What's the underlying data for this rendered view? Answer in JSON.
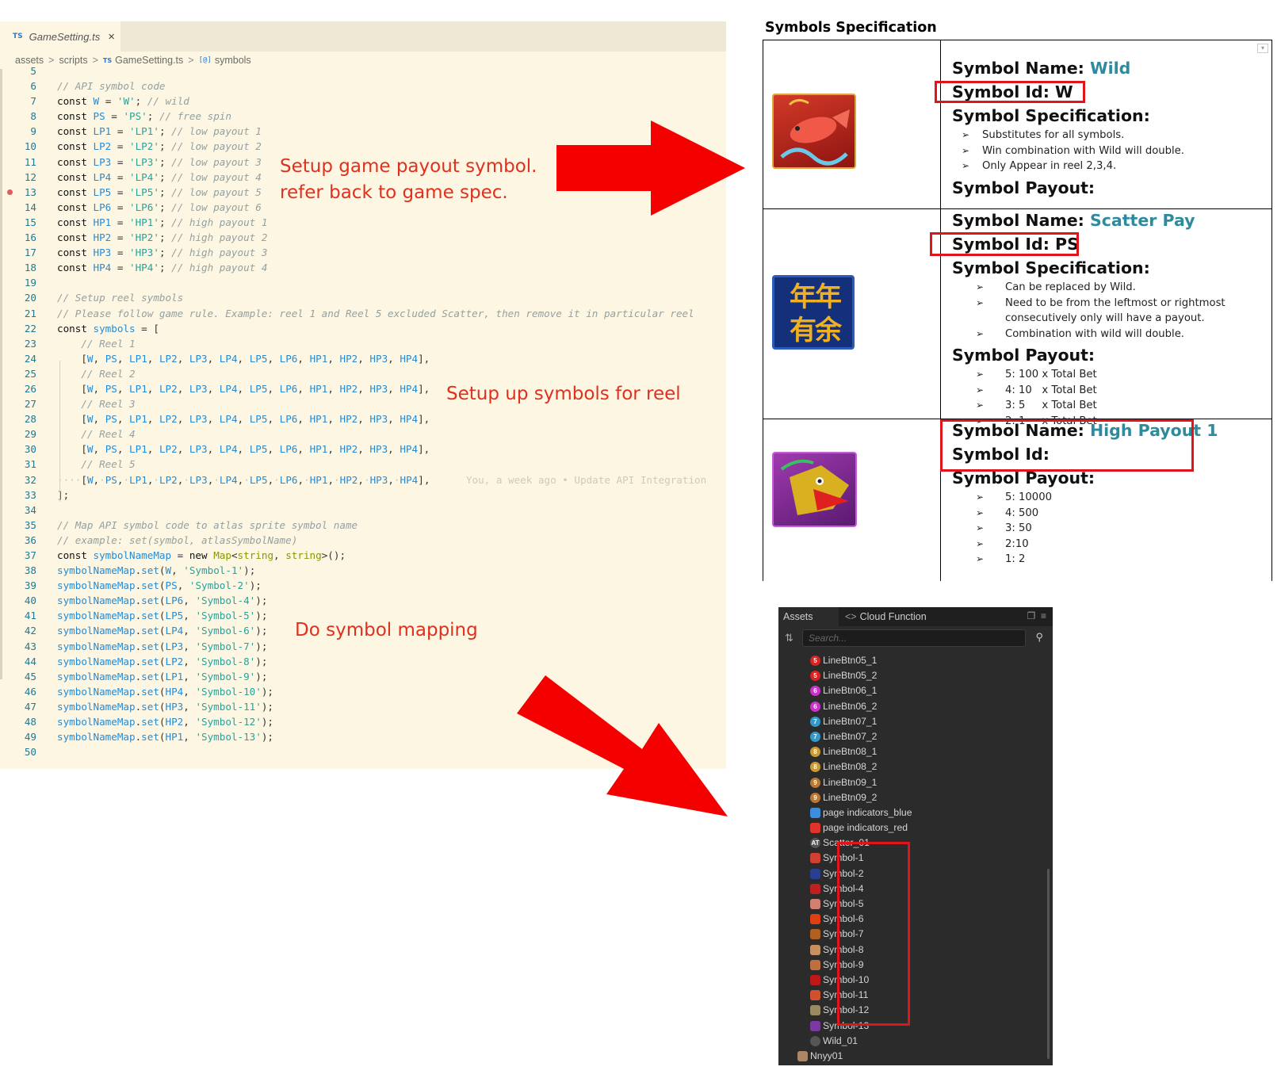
{
  "editor": {
    "tab": {
      "lang": "TS",
      "filename": "GameSetting.ts",
      "close": "×"
    },
    "breadcrumb": {
      "parts": [
        "assets",
        "scripts",
        "GameSetting.ts",
        "symbols"
      ],
      "sep": ">",
      "ts": "TS",
      "sym": "[@]"
    },
    "lines": [
      {
        "n": "5",
        "t": ""
      },
      {
        "n": "6",
        "t": "<span class='c'>// API symbol code</span>"
      },
      {
        "n": "7",
        "t": "<span class='k'>const</span> <span class='v'>W</span> = <span class='s'>'W'</span>; <span class='c'>// wild</span>"
      },
      {
        "n": "8",
        "t": "<span class='k'>const</span> <span class='v'>PS</span> = <span class='s'>'PS'</span>; <span class='c'>// free spin</span>"
      },
      {
        "n": "9",
        "t": "<span class='k'>const</span> <span class='v'>LP1</span> = <span class='s'>'LP1'</span>; <span class='c'>// low payout 1</span>"
      },
      {
        "n": "10",
        "t": "<span class='k'>const</span> <span class='v'>LP2</span> = <span class='s'>'LP2'</span>; <span class='c'>// low payout 2</span>"
      },
      {
        "n": "11",
        "t": "<span class='k'>const</span> <span class='v'>LP3</span> = <span class='s'>'LP3'</span>; <span class='c'>// low payout 3</span>"
      },
      {
        "n": "12",
        "t": "<span class='k'>const</span> <span class='v'>LP4</span> = <span class='s'>'LP4'</span>; <span class='c'>// low payout 4</span>"
      },
      {
        "n": "13",
        "t": "<span class='k'>const</span> <span class='v'>LP5</span> = <span class='s'>'LP5'</span>; <span class='c'>// low payout 5</span>",
        "bp": true
      },
      {
        "n": "14",
        "t": "<span class='k'>const</span> <span class='v'>LP6</span> = <span class='s'>'LP6'</span>; <span class='c'>// low payout 6</span>"
      },
      {
        "n": "15",
        "t": "<span class='k'>const</span> <span class='v'>HP1</span> = <span class='s'>'HP1'</span>; <span class='c'>// high payout 1</span>"
      },
      {
        "n": "16",
        "t": "<span class='k'>const</span> <span class='v'>HP2</span> = <span class='s'>'HP2'</span>; <span class='c'>// high payout 2</span>"
      },
      {
        "n": "17",
        "t": "<span class='k'>const</span> <span class='v'>HP3</span> = <span class='s'>'HP3'</span>; <span class='c'>// high payout 3</span>"
      },
      {
        "n": "18",
        "t": "<span class='k'>const</span> <span class='v'>HP4</span> = <span class='s'>'HP4'</span>; <span class='c'>// high payout 4</span>"
      },
      {
        "n": "19",
        "t": ""
      },
      {
        "n": "20",
        "t": "<span class='c'>// Setup reel symbols</span>"
      },
      {
        "n": "21",
        "t": "<span class='c'>// Please follow game rule. Example: reel 1 and Reel 5 excluded Scatter, then remove it in particular reel</span>"
      },
      {
        "n": "22",
        "t": "<span class='k'>const</span> <span class='v'>symbols</span> = ["
      },
      {
        "n": "23",
        "t": "    <span class='c'>// Reel 1</span>"
      },
      {
        "n": "24",
        "t": "    [<span class='v'>W</span>, <span class='v'>PS</span>, <span class='v'>LP1</span>, <span class='v'>LP2</span>, <span class='v'>LP3</span>, <span class='v'>LP4</span>, <span class='v'>LP5</span>, <span class='v'>LP6</span>, <span class='v'>HP1</span>, <span class='v'>HP2</span>, <span class='v'>HP3</span>, <span class='v'>HP4</span>],"
      },
      {
        "n": "25",
        "t": "    <span class='c'>// Reel 2</span>"
      },
      {
        "n": "26",
        "t": "    [<span class='v'>W</span>, <span class='v'>PS</span>, <span class='v'>LP1</span>, <span class='v'>LP2</span>, <span class='v'>LP3</span>, <span class='v'>LP4</span>, <span class='v'>LP5</span>, <span class='v'>LP6</span>, <span class='v'>HP1</span>, <span class='v'>HP2</span>, <span class='v'>HP3</span>, <span class='v'>HP4</span>],"
      },
      {
        "n": "27",
        "t": "    <span class='c'>// Reel 3</span>"
      },
      {
        "n": "28",
        "t": "    [<span class='v'>W</span>, <span class='v'>PS</span>, <span class='v'>LP1</span>, <span class='v'>LP2</span>, <span class='v'>LP3</span>, <span class='v'>LP4</span>, <span class='v'>LP5</span>, <span class='v'>LP6</span>, <span class='v'>HP1</span>, <span class='v'>HP2</span>, <span class='v'>HP3</span>, <span class='v'>HP4</span>],"
      },
      {
        "n": "29",
        "t": "    <span class='c'>// Reel 4</span>"
      },
      {
        "n": "30",
        "t": "    [<span class='v'>W</span>, <span class='v'>PS</span>, <span class='v'>LP1</span>, <span class='v'>LP2</span>, <span class='v'>LP3</span>, <span class='v'>LP4</span>, <span class='v'>LP5</span>, <span class='v'>LP6</span>, <span class='v'>HP1</span>, <span class='v'>HP2</span>, <span class='v'>HP3</span>, <span class='v'>HP4</span>],"
      },
      {
        "n": "31",
        "t": "    <span class='c'>// Reel 5</span>"
      },
      {
        "n": "32",
        "t": "<span class='ws'>····</span>[<span class='v'>W</span>,<span class='ws'>·</span><span class='v'>PS</span>,<span class='ws'>·</span><span class='v'>LP1</span>,<span class='ws'>·</span><span class='v'>LP2</span>,<span class='ws'>·</span><span class='v'>LP3</span>,<span class='ws'>·</span><span class='v'>LP4</span>,<span class='ws'>·</span><span class='v'>LP5</span>,<span class='ws'>·</span><span class='v'>LP6</span>,<span class='ws'>·</span><span class='v'>HP1</span>,<span class='ws'>·</span><span class='v'>HP2</span>,<span class='ws'>·</span><span class='v'>HP3</span>,<span class='ws'>·</span><span class='v'>HP4</span>],      <span class='blame'>You, a week ago • Update API Integration</span>"
      },
      {
        "n": "33",
        "t": "];"
      },
      {
        "n": "34",
        "t": ""
      },
      {
        "n": "35",
        "t": "<span class='c'>// Map API symbol code to atlas sprite symbol name</span>"
      },
      {
        "n": "36",
        "t": "<span class='c'>// example: set(symbol, atlasSymbolName)</span>"
      },
      {
        "n": "37",
        "t": "<span class='k'>const</span> <span class='v'>symbolNameMap</span> = <span class='k'>new</span> <span class='t'>Map</span>&lt;<span class='t'>string</span>, <span class='t'>string</span>&gt;();"
      },
      {
        "n": "38",
        "t": "<span class='v'>symbolNameMap</span>.<span class='f'>set</span>(<span class='v'>W</span>, <span class='s'>'Symbol-1'</span>);"
      },
      {
        "n": "39",
        "t": "<span class='v'>symbolNameMap</span>.<span class='f'>set</span>(<span class='v'>PS</span>, <span class='s'>'Symbol-2'</span>);"
      },
      {
        "n": "40",
        "t": "<span class='v'>symbolNameMap</span>.<span class='f'>set</span>(<span class='v'>LP6</span>, <span class='s'>'Symbol-4'</span>);"
      },
      {
        "n": "41",
        "t": "<span class='v'>symbolNameMap</span>.<span class='f'>set</span>(<span class='v'>LP5</span>, <span class='s'>'Symbol-5'</span>);"
      },
      {
        "n": "42",
        "t": "<span class='v'>symbolNameMap</span>.<span class='f'>set</span>(<span class='v'>LP4</span>, <span class='s'>'Symbol-6'</span>);"
      },
      {
        "n": "43",
        "t": "<span class='v'>symbolNameMap</span>.<span class='f'>set</span>(<span class='v'>LP3</span>, <span class='s'>'Symbol-7'</span>);"
      },
      {
        "n": "44",
        "t": "<span class='v'>symbolNameMap</span>.<span class='f'>set</span>(<span class='v'>LP2</span>, <span class='s'>'Symbol-8'</span>);"
      },
      {
        "n": "45",
        "t": "<span class='v'>symbolNameMap</span>.<span class='f'>set</span>(<span class='v'>LP1</span>, <span class='s'>'Symbol-9'</span>);"
      },
      {
        "n": "46",
        "t": "<span class='v'>symbolNameMap</span>.<span class='f'>set</span>(<span class='v'>HP4</span>, <span class='s'>'Symbol-10'</span>);"
      },
      {
        "n": "47",
        "t": "<span class='v'>symbolNameMap</span>.<span class='f'>set</span>(<span class='v'>HP3</span>, <span class='s'>'Symbol-11'</span>);"
      },
      {
        "n": "48",
        "t": "<span class='v'>symbolNameMap</span>.<span class='f'>set</span>(<span class='v'>HP2</span>, <span class='s'>'Symbol-12'</span>);"
      },
      {
        "n": "49",
        "t": "<span class='v'>symbolNameMap</span>.<span class='f'>set</span>(<span class='v'>HP1</span>, <span class='s'>'Symbol-13'</span>);"
      },
      {
        "n": "50",
        "t": ""
      }
    ]
  },
  "annotations": {
    "payout_line1": "Setup game payout symbol.",
    "payout_line2": "refer back to game spec.",
    "reel": "Setup up symbols for reel",
    "mapping": "Do symbol mapping",
    "color": "#e0301e"
  },
  "spec": {
    "title": "Symbols Specification",
    "wild": {
      "name_label": "Symbol Name: ",
      "name_value": "Wild",
      "id": "Symbol Id: W",
      "spec_label": "Symbol Specification:",
      "bullets": [
        "Substitutes for all symbols.",
        "Win combination with Wild will double.",
        "Only Appear in reel 2,3,4."
      ],
      "payout_label": "Symbol Payout:"
    },
    "scatter": {
      "name_label": "Symbol Name: ",
      "name_value": "Scatter Pay",
      "id": "Symbol Id: PS",
      "spec_label": "Symbol Specification:",
      "bullets": [
        "Can be replaced by Wild.",
        "Need to be from the leftmost or rightmost consecutively only will have a payout.",
        "Combination with wild will double."
      ],
      "payout_label": "Symbol Payout:",
      "payouts": [
        "5: 100 x Total Bet",
        "4: 10   x Total Bet",
        "3: 5     x Total Bet",
        "2: 1     x Total Bet"
      ]
    },
    "hp1": {
      "name_label": "Symbol Name: ",
      "name_value": "High Payout 1",
      "id": "Symbol Id:",
      "payout_label": "Symbol Payout:",
      "payouts": [
        "5: 10000",
        "4: 500",
        "3: 50",
        "2:10",
        "1: 2"
      ]
    },
    "scatter_icon_chars": [
      "年",
      "年",
      "有",
      "余"
    ],
    "bullet_mark": "➢",
    "accent": "#2e8b9e",
    "box_color": "#e0141b"
  },
  "assets_panel": {
    "tab_assets": "Assets",
    "tab_cloud": "Cloud Function",
    "search_placeholder": "Search...",
    "items": [
      {
        "label": "LineBtn05_1",
        "badge": "5",
        "color": "#d22"
      },
      {
        "label": "LineBtn05_2",
        "badge": "5",
        "color": "#d22"
      },
      {
        "label": "LineBtn06_1",
        "badge": "6",
        "color": "#c3c"
      },
      {
        "label": "LineBtn06_2",
        "badge": "6",
        "color": "#c3c"
      },
      {
        "label": "LineBtn07_1",
        "badge": "7",
        "color": "#39c"
      },
      {
        "label": "LineBtn07_2",
        "badge": "7",
        "color": "#39c"
      },
      {
        "label": "LineBtn08_1",
        "badge": "8",
        "color": "#c93"
      },
      {
        "label": "LineBtn08_2",
        "badge": "8",
        "color": "#c93"
      },
      {
        "label": "LineBtn09_1",
        "badge": "9",
        "color": "#b73"
      },
      {
        "label": "LineBtn09_2",
        "badge": "9",
        "color": "#b73"
      },
      {
        "label": "page indicators_blue",
        "badge": "",
        "color": "#3a8de0"
      },
      {
        "label": "page indicators_red",
        "badge": "",
        "color": "#e0342a"
      },
      {
        "label": "Scatter_01",
        "badge": "AT",
        "color": "#555"
      },
      {
        "label": "Symbol-1",
        "badge": "",
        "color": "#d04030"
      },
      {
        "label": "Symbol-2",
        "badge": "",
        "color": "#2a3f8f"
      },
      {
        "label": "Symbol-4",
        "badge": "",
        "color": "#c02020"
      },
      {
        "label": "Symbol-5",
        "badge": "",
        "color": "#d08070"
      },
      {
        "label": "Symbol-6",
        "badge": "",
        "color": "#e04010"
      },
      {
        "label": "Symbol-7",
        "badge": "",
        "color": "#b06020"
      },
      {
        "label": "Symbol-8",
        "badge": "",
        "color": "#c89060"
      },
      {
        "label": "Symbol-9",
        "badge": "",
        "color": "#c07040"
      },
      {
        "label": "Symbol-10",
        "badge": "",
        "color": "#c01818"
      },
      {
        "label": "Symbol-11",
        "badge": "",
        "color": "#d05030"
      },
      {
        "label": "Symbol-12",
        "badge": "",
        "color": "#9a8a60"
      },
      {
        "label": "Symbol-13",
        "badge": "",
        "color": "#7a3aa0"
      },
      {
        "label": "Wild_01",
        "badge": "",
        "color": "#555"
      },
      {
        "label": "Nnyy01",
        "badge": "",
        "color": "#a86"
      }
    ]
  }
}
